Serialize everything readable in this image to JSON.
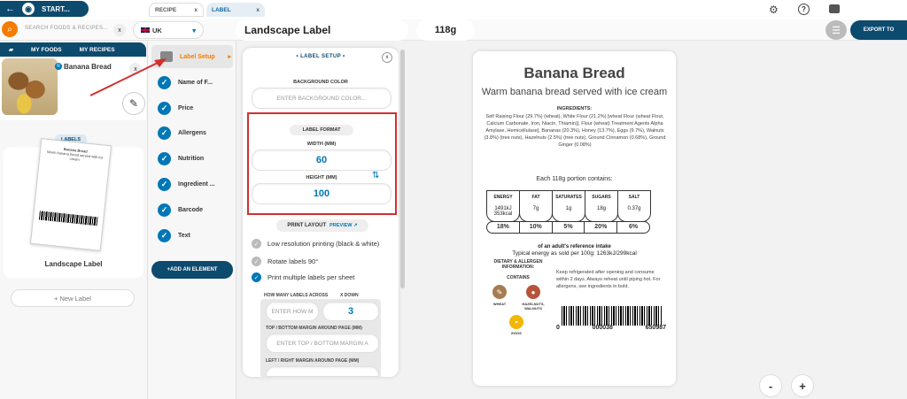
{
  "topbar": {
    "start_label": "START...",
    "tabs": [
      {
        "label": "RECIPE",
        "close": "x"
      },
      {
        "label": "LABEL",
        "close": "x"
      }
    ],
    "icons": [
      "gear-icon",
      "help-icon",
      "chat-icon"
    ]
  },
  "searchbar": {
    "placeholder": "SEARCH FOODS & RECIPES...",
    "clear": "x",
    "dropdown": "▾",
    "country": "UK",
    "label_name": "Landscape Label",
    "weight": "118g",
    "export": "EXPORT TO"
  },
  "left": {
    "tabs": [
      "MY FOODS",
      "MY RECIPES"
    ],
    "recipe_name": "Banana Bread",
    "recipe_close": "x",
    "labels_badge": "LABELS",
    "card_name": "Landscape Label",
    "new_label": "+ New Label",
    "mini_title": "Banana Bread",
    "mini_sub": "Warm banana bread served with ice cream"
  },
  "elements": {
    "setup": "Label Setup",
    "items": [
      "Name of F...",
      "Price",
      "Allergens",
      "Nutrition",
      "Ingredient ...",
      "Barcode",
      "Text"
    ],
    "add": "+ADD AN ELEMENT"
  },
  "setup_panel": {
    "title": "• LABEL SETUP •",
    "close": "x",
    "bg_label": "BACKGROUND COLOR",
    "bg_placeholder": "ENTER BACKGROUND COLOR...",
    "format_btn": "LABEL FORMAT",
    "width_label": "WIDTH (MM)",
    "width_value": "60",
    "height_label": "HEIGHT (MM)",
    "height_value": "100",
    "layout_btn": "PRINT LAYOUT",
    "preview": "PREVIEW ↗",
    "options": [
      {
        "label": "Low resolution printing (black & white)",
        "on": false
      },
      {
        "label": "Rotate labels 90°",
        "on": false
      },
      {
        "label": "Print multiple labels per sheet",
        "on": true
      }
    ],
    "across_label": "HOW MANY LABELS ACROSS",
    "down_label": "X DOWN",
    "across_placeholder": "ENTER HOW M",
    "down_value": "3",
    "tb_label": "TOP / BOTTOM MARGIN AROUND PAGE (MM)",
    "tb_placeholder": "ENTER TOP / BOTTOM MARGIN A",
    "lr_label": "LEFT / RIGHT MARGIN AROUND PAGE (MM)"
  },
  "preview": {
    "title": "Banana Bread",
    "subtitle": "Warm banana bread served with ice cream",
    "ingredients_heading": "INGREDIENTS:",
    "ingredients": "Self Raising Flour (29.7%) (wheat), White Flour (21.2%) [wheat Flour (wheat Flour, Calcium Carbonate, Iron, Niacin, Thiamin)], Flour (wheat) Treatment Agents Alpha Amylase, Hemicellulase], Bananas (20.3%), Honey (13.7%), Eggs (9.7%), Walnuts (3.8%) (tree nuts), Hazelnuts (2.5%) (tree nuts), Ground Cinnamon (0.68%), Ground Ginger (0.08%)",
    "portion": "Each 118g portion contains:",
    "nutrition": [
      {
        "name": "ENERGY",
        "value": "1491kJ 353kcal",
        "pct": "18%"
      },
      {
        "name": "FAT",
        "value": "7g",
        "pct": "10%"
      },
      {
        "name": "SATURATES",
        "value": "1g",
        "pct": "5%"
      },
      {
        "name": "SUGARS",
        "value": "18g",
        "pct": "20%"
      },
      {
        "name": "SALT",
        "value": "0.37g",
        "pct": "6%"
      }
    ],
    "ri": "of an adult's reference intake",
    "typical": "Typical energy as sold per 100g: 1263kJ/299kcal",
    "diet_heading": "DIETARY & ALLERGEN INFORMATION:",
    "contains": "CONTAINS",
    "allergens": [
      {
        "label": "WHEAT",
        "color": "#a67c52"
      },
      {
        "label": "HAZELNUTS, WALNUTS",
        "color": "#b5543a"
      },
      {
        "label": "EGGS",
        "color": "#f2b705"
      }
    ],
    "storage": "Keep refrigerated after opening and consume within 2 days. Always reheat until piping hot. For allergens, see ingredients in bold.",
    "barcode": [
      "0",
      "000038",
      "650987"
    ]
  },
  "zoom": {
    "minus": "-",
    "plus": "+"
  },
  "colors": {
    "navy": "#0c4a6e",
    "orange": "#f57c00",
    "blue": "#0077b6",
    "red": "#d32f2f"
  }
}
